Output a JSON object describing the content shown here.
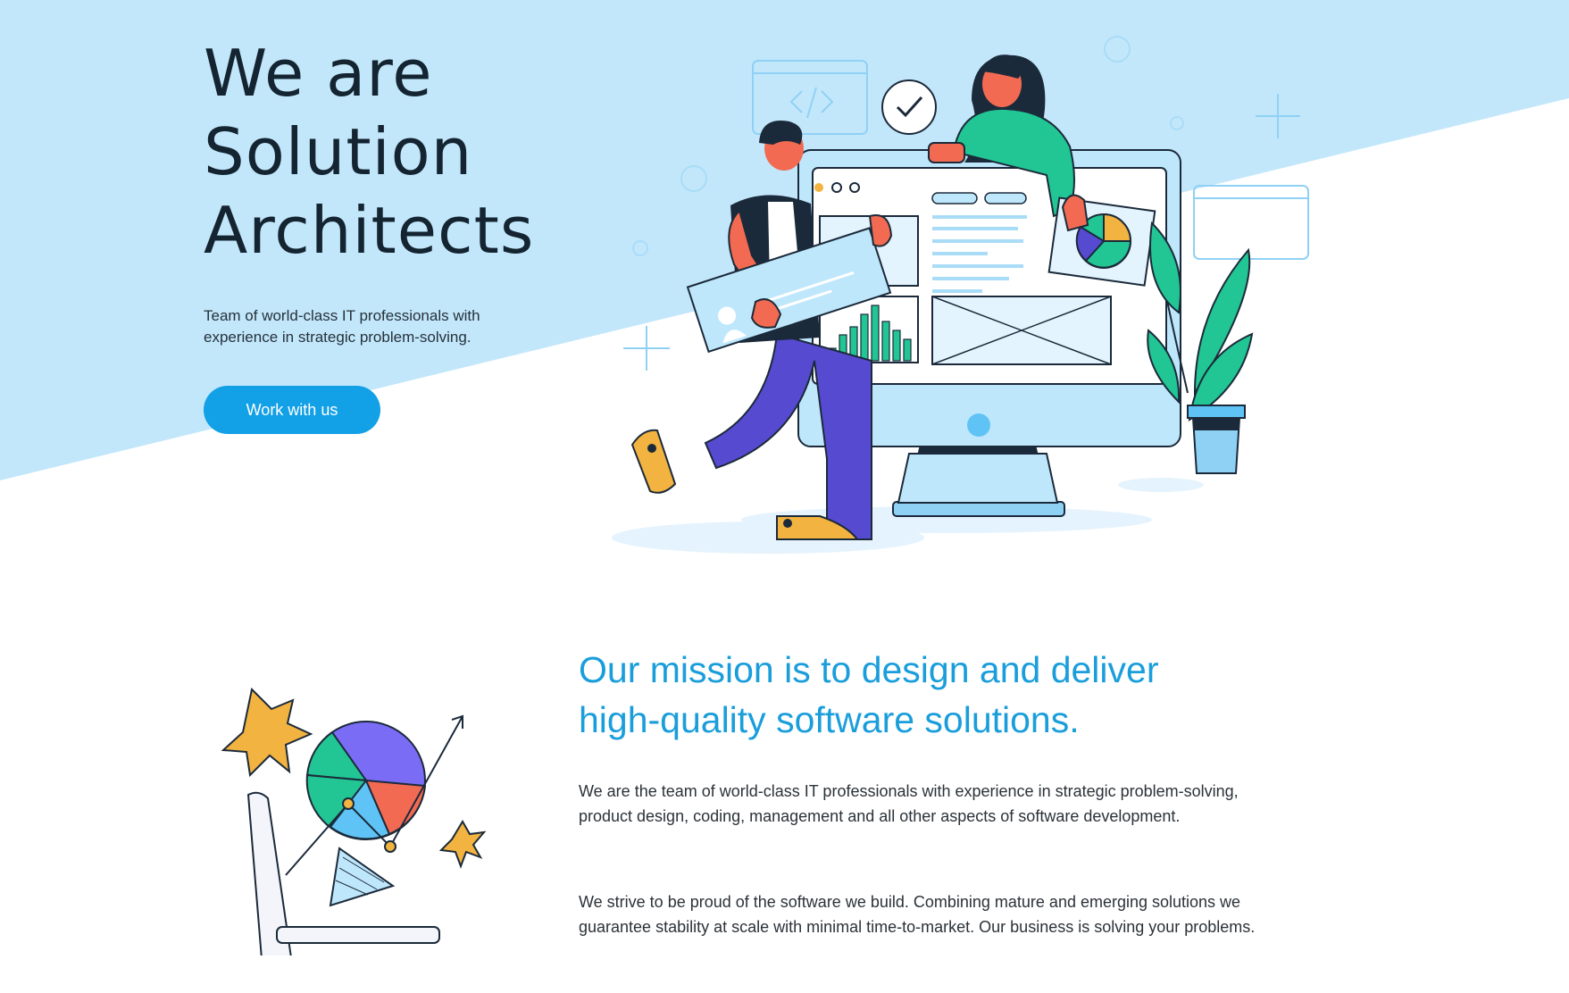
{
  "hero": {
    "title_lines": [
      "We are",
      "Solution",
      "Architects"
    ],
    "subtitle": "Team of world-class IT professionals with experience in strategic problem-solving.",
    "cta_label": "Work with us"
  },
  "mission": {
    "title_lines": [
      "Our mission is to design and deliver",
      "high-quality software solutions."
    ],
    "paragraph_1": "We are the team of world-class IT professionals with experience in strategic problem-solving, product design, coding, management and all other aspects of software development.",
    "paragraph_2": "We strive to be proud of the software we build. Combining mature and emerging solutions we guarantee stability at scale with minimal time-to-market. Our business is solving your problems."
  },
  "colors": {
    "hero_background": "#c2e7fb",
    "accent": "#12a0e6",
    "mission_title": "#1a9edb"
  },
  "icons": [
    "code-window-icon",
    "checkmark-bubble-icon",
    "browser-window-icon",
    "plus-sparkle-icon",
    "pie-chart-icon",
    "star-burst-icon",
    "trend-arrow-icon"
  ]
}
